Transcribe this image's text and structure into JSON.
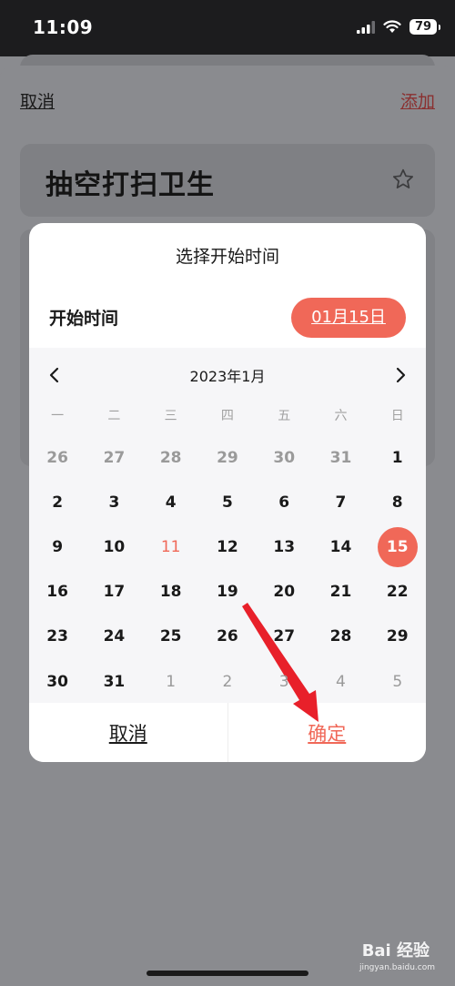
{
  "status_bar": {
    "time": "11:09",
    "battery": "79"
  },
  "sheet": {
    "cancel_label": "取消",
    "add_label": "添加",
    "task_title": "抽空打扫卫生"
  },
  "dialog": {
    "title": "选择开始时间",
    "row_label": "开始时间",
    "selected_date": "01月15日",
    "month_title": "2023年1月",
    "weekdays": [
      "一",
      "二",
      "三",
      "四",
      "五",
      "六",
      "日"
    ],
    "weeks": [
      [
        "26",
        "27",
        "28",
        "29",
        "30",
        "31",
        "1"
      ],
      [
        "2",
        "3",
        "4",
        "5",
        "6",
        "7",
        "8"
      ],
      [
        "9",
        "10",
        "11",
        "12",
        "13",
        "14",
        "15"
      ],
      [
        "16",
        "17",
        "18",
        "19",
        "20",
        "21",
        "22"
      ],
      [
        "23",
        "24",
        "25",
        "26",
        "27",
        "28",
        "29"
      ],
      [
        "30",
        "31",
        "1",
        "2",
        "3",
        "4",
        "5"
      ]
    ],
    "cancel_label": "取消",
    "confirm_label": "确定"
  },
  "watermark": {
    "brand": "Bai 经验",
    "site": "jingyan.baidu.com"
  },
  "colors": {
    "accent": "#f06858",
    "overlay": "#8a8b8f",
    "arrow": "#e8202a"
  }
}
